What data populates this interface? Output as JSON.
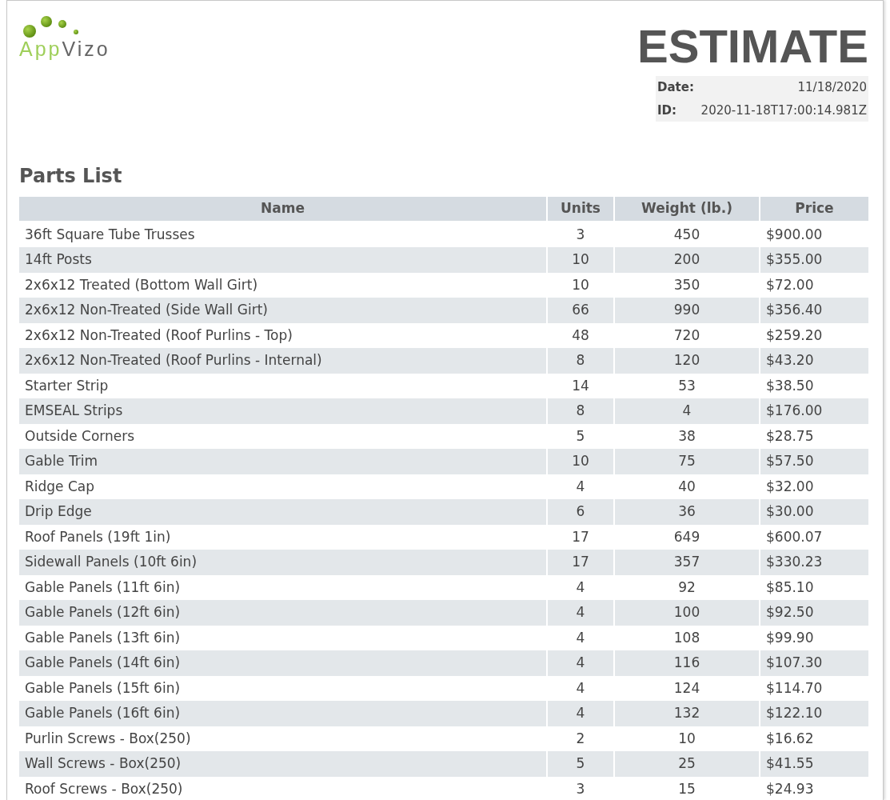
{
  "logo": {
    "part_1": "App",
    "part_2": "Vizo"
  },
  "document": {
    "title": "ESTIMATE",
    "meta": [
      {
        "label": "Date:",
        "value": "11/18/2020"
      },
      {
        "label": "ID:",
        "value": "2020-11-18T17:00:14.981Z"
      }
    ]
  },
  "section_title": "Parts List",
  "table": {
    "columns": [
      "Name",
      "Units",
      "Weight (lb.)",
      "Price"
    ],
    "rows": [
      [
        "36ft Square Tube Trusses",
        "3",
        "450",
        "$900.00"
      ],
      [
        "14ft Posts",
        "10",
        "200",
        "$355.00"
      ],
      [
        "2x6x12 Treated (Bottom Wall Girt)",
        "10",
        "350",
        "$72.00"
      ],
      [
        "2x6x12 Non-Treated (Side Wall Girt)",
        "66",
        "990",
        "$356.40"
      ],
      [
        "2x6x12 Non-Treated (Roof Purlins - Top)",
        "48",
        "720",
        "$259.20"
      ],
      [
        "2x6x12 Non-Treated (Roof Purlins - Internal)",
        "8",
        "120",
        "$43.20"
      ],
      [
        "Starter Strip",
        "14",
        "53",
        "$38.50"
      ],
      [
        "EMSEAL Strips",
        "8",
        "4",
        "$176.00"
      ],
      [
        "Outside Corners",
        "5",
        "38",
        "$28.75"
      ],
      [
        "Gable Trim",
        "10",
        "75",
        "$57.50"
      ],
      [
        "Ridge Cap",
        "4",
        "40",
        "$32.00"
      ],
      [
        "Drip Edge",
        "6",
        "36",
        "$30.00"
      ],
      [
        "Roof Panels (19ft 1in)",
        "17",
        "649",
        "$600.07"
      ],
      [
        "Sidewall Panels (10ft 6in)",
        "17",
        "357",
        "$330.23"
      ],
      [
        "Gable Panels (11ft 6in)",
        "4",
        "92",
        "$85.10"
      ],
      [
        "Gable Panels (12ft 6in)",
        "4",
        "100",
        "$92.50"
      ],
      [
        "Gable Panels (13ft 6in)",
        "4",
        "108",
        "$99.90"
      ],
      [
        "Gable Panels (14ft 6in)",
        "4",
        "116",
        "$107.30"
      ],
      [
        "Gable Panels (15ft 6in)",
        "4",
        "124",
        "$114.70"
      ],
      [
        "Gable Panels (16ft 6in)",
        "4",
        "132",
        "$122.10"
      ],
      [
        "Purlin Screws - Box(250)",
        "2",
        "10",
        "$16.62"
      ],
      [
        "Wall Screws - Box(250)",
        "5",
        "25",
        "$41.55"
      ],
      [
        "Roof Screws - Box(250)",
        "3",
        "15",
        "$24.93"
      ]
    ]
  }
}
